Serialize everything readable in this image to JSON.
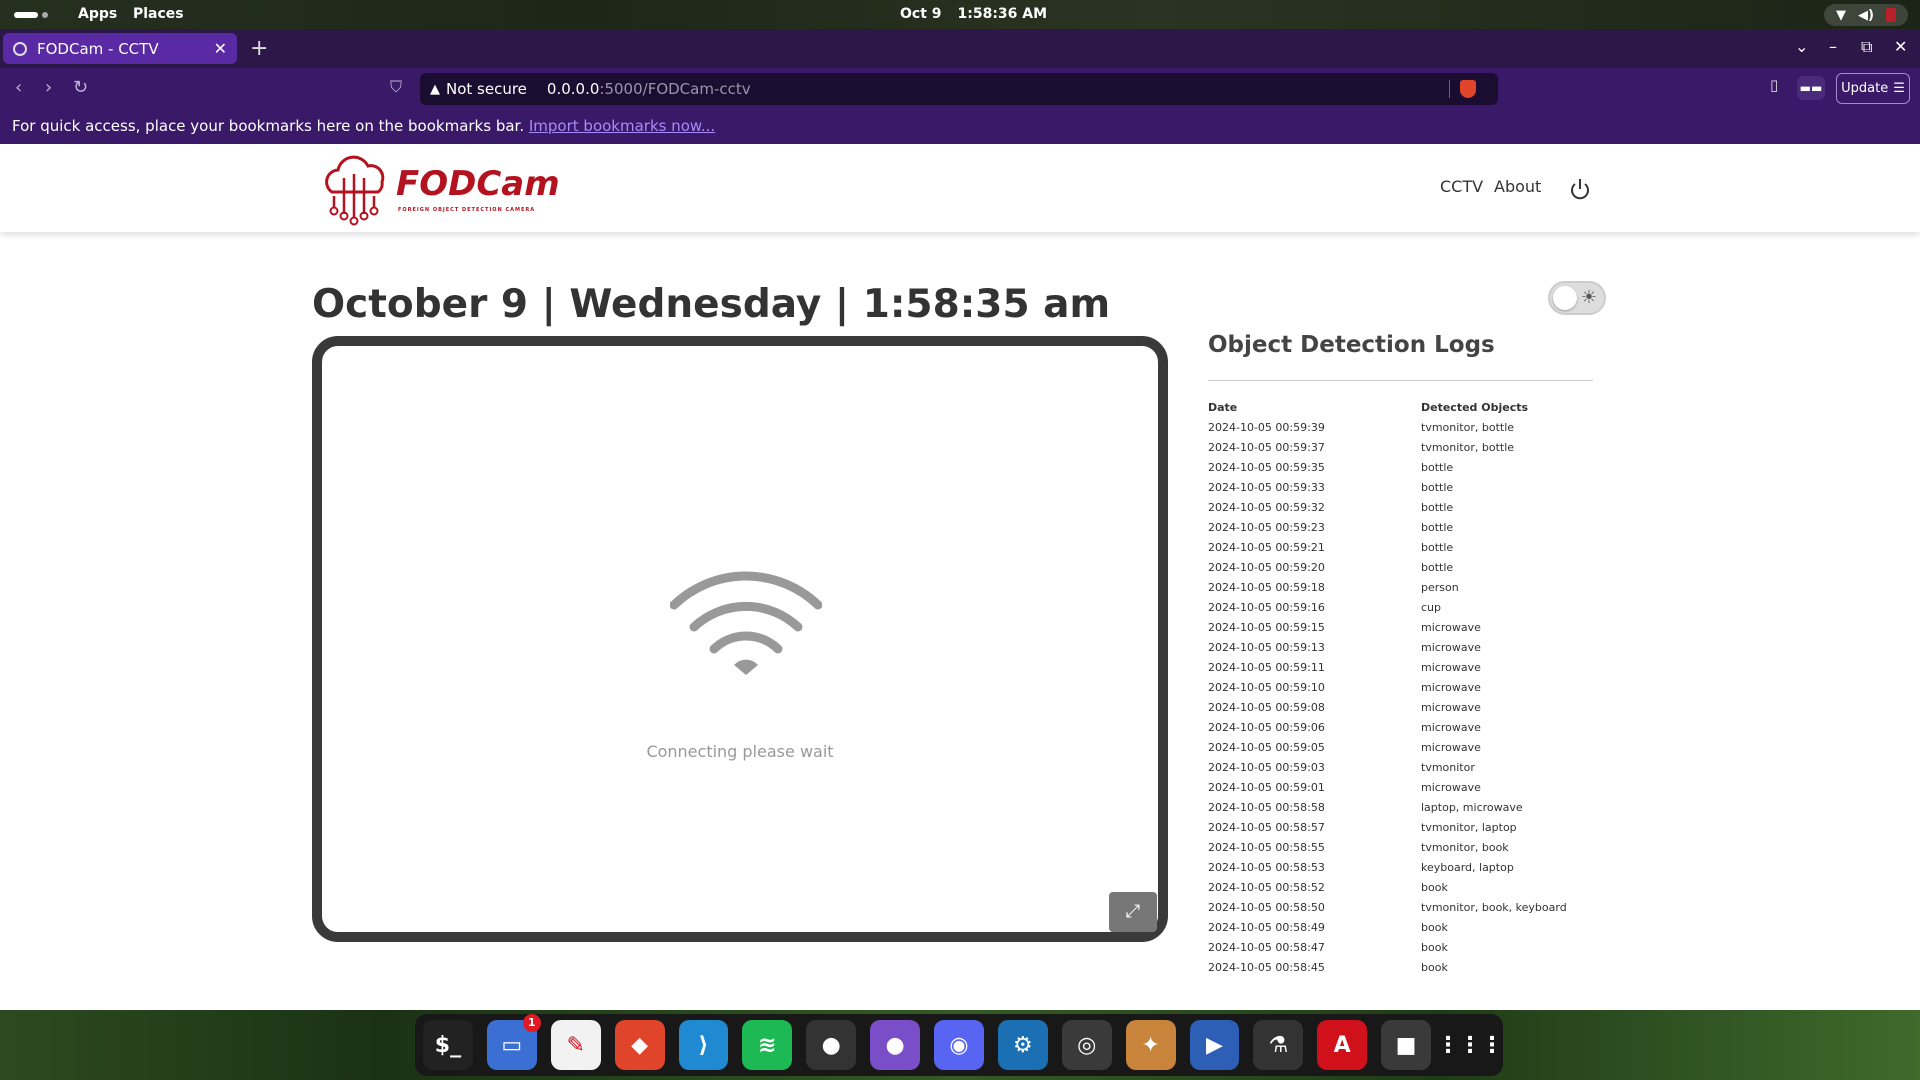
{
  "topbar": {
    "apps": "Apps",
    "places": "Places",
    "date": "Oct 9",
    "time": "1:58:36 AM"
  },
  "browser": {
    "tab_title": "FODCam - CCTV",
    "new_tab": "+",
    "security_label": "Not secure",
    "url_host": "0.0.0.0",
    "url_path": ":5000/FODCam-cctv",
    "update_label": "Update",
    "bookmarks_text": "For quick access, place your bookmarks here on the bookmarks bar.",
    "bookmarks_link": "Import bookmarks now..."
  },
  "site": {
    "brand": "FODCam",
    "tagline": "FOREIGN OBJECT DETECTION CAMERA",
    "nav": [
      "CCTV",
      "About"
    ],
    "date_title": "October 9 | Wednesday | 1:58:35 am",
    "connecting": "Connecting please wait",
    "logs_title": "Object Detection Logs",
    "logs_columns": [
      "Date",
      "Detected Objects"
    ],
    "logs": [
      [
        "2024-10-05 00:59:39",
        "tvmonitor, bottle"
      ],
      [
        "2024-10-05 00:59:37",
        "tvmonitor, bottle"
      ],
      [
        "2024-10-05 00:59:35",
        "bottle"
      ],
      [
        "2024-10-05 00:59:33",
        "bottle"
      ],
      [
        "2024-10-05 00:59:32",
        "bottle"
      ],
      [
        "2024-10-05 00:59:23",
        "bottle"
      ],
      [
        "2024-10-05 00:59:21",
        "bottle"
      ],
      [
        "2024-10-05 00:59:20",
        "bottle"
      ],
      [
        "2024-10-05 00:59:18",
        "person"
      ],
      [
        "2024-10-05 00:59:16",
        "cup"
      ],
      [
        "2024-10-05 00:59:15",
        "microwave"
      ],
      [
        "2024-10-05 00:59:13",
        "microwave"
      ],
      [
        "2024-10-05 00:59:11",
        "microwave"
      ],
      [
        "2024-10-05 00:59:10",
        "microwave"
      ],
      [
        "2024-10-05 00:59:08",
        "microwave"
      ],
      [
        "2024-10-05 00:59:06",
        "microwave"
      ],
      [
        "2024-10-05 00:59:05",
        "microwave"
      ],
      [
        "2024-10-05 00:59:03",
        "tvmonitor"
      ],
      [
        "2024-10-05 00:59:01",
        "microwave"
      ],
      [
        "2024-10-05 00:58:58",
        "laptop, microwave"
      ],
      [
        "2024-10-05 00:58:57",
        "tvmonitor, laptop"
      ],
      [
        "2024-10-05 00:58:55",
        "tvmonitor, book"
      ],
      [
        "2024-10-05 00:58:53",
        "keyboard, laptop"
      ],
      [
        "2024-10-05 00:58:52",
        "book"
      ],
      [
        "2024-10-05 00:58:50",
        "tvmonitor, book, keyboard"
      ],
      [
        "2024-10-05 00:58:49",
        "book"
      ],
      [
        "2024-10-05 00:58:47",
        "book"
      ],
      [
        "2024-10-05 00:58:45",
        "book"
      ]
    ]
  },
  "dock": {
    "files_badge": "1",
    "apps": [
      {
        "name": "terminal-icon",
        "glyph": "$_",
        "color": "#222222"
      },
      {
        "name": "files-icon",
        "glyph": "▭",
        "color": "#3b6fd4"
      },
      {
        "name": "text-editor-icon",
        "glyph": "✎",
        "color": "#f2f2f2"
      },
      {
        "name": "brave-icon",
        "glyph": "◆",
        "color": "#e0452b"
      },
      {
        "name": "vscode-icon",
        "glyph": "⟩",
        "color": "#1f8ad2"
      },
      {
        "name": "spotify-icon",
        "glyph": "≋",
        "color": "#1db954"
      },
      {
        "name": "github-icon",
        "glyph": "●",
        "color": "#333333"
      },
      {
        "name": "github-desktop-icon",
        "glyph": "●",
        "color": "#7b4ec9"
      },
      {
        "name": "discord-icon",
        "glyph": "◉",
        "color": "#5865f2"
      },
      {
        "name": "steam-icon",
        "glyph": "⚙",
        "color": "#1b6fb3"
      },
      {
        "name": "obs-icon",
        "glyph": "◎",
        "color": "#3a3a3a"
      },
      {
        "name": "game-icon",
        "glyph": "✦",
        "color": "#c8843a"
      },
      {
        "name": "video-editor-icon",
        "glyph": "▶",
        "color": "#2c5fb5"
      },
      {
        "name": "inkscape-icon",
        "glyph": "⚗",
        "color": "#333333"
      },
      {
        "name": "pdf-icon",
        "glyph": "A",
        "color": "#d0101a"
      },
      {
        "name": "screen-recorder-icon",
        "glyph": "■",
        "color": "#3a3a3a"
      },
      {
        "name": "app-grid-icon",
        "glyph": "⋮⋮⋮",
        "color": "#181818"
      }
    ]
  }
}
